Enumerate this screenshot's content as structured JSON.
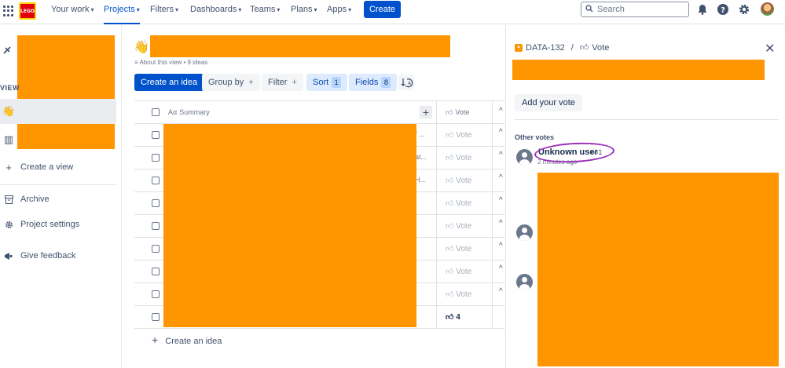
{
  "topnav": {
    "logo_text": "LEGO",
    "items": [
      {
        "label": "Your work",
        "active": false
      },
      {
        "label": "Projects",
        "active": true
      },
      {
        "label": "Filters",
        "active": false
      },
      {
        "label": "Dashboards",
        "active": false
      },
      {
        "label": "Teams",
        "active": false
      },
      {
        "label": "Plans",
        "active": false
      },
      {
        "label": "Apps",
        "active": false
      }
    ],
    "create_label": "Create",
    "search_placeholder": "Search",
    "icons": [
      "notifications-icon",
      "help-icon",
      "settings-icon"
    ]
  },
  "sidebar": {
    "views_label": "VIEW",
    "items": [
      {
        "label": "Create a view",
        "icon": "plus-icon"
      },
      {
        "label": "Archive",
        "icon": "archive-icon"
      },
      {
        "label": "Project settings",
        "icon": "gear-icon"
      },
      {
        "label": "Give feedback",
        "icon": "megaphone-icon"
      }
    ]
  },
  "main": {
    "about": "About this view • 9 ideas",
    "toolbar": {
      "create_idea": "Create an idea",
      "group_by": "Group by",
      "filter": "Filter",
      "sort": "Sort",
      "sort_count": "1",
      "fields": "Fields",
      "fields_count": "8"
    },
    "table": {
      "summary_header": "Summary",
      "summary_prefix": "Aα",
      "vote_header": "Vote",
      "rows": [
        {
          "trail": "f ...",
          "vote": "Vote",
          "caret": "^"
        },
        {
          "trail": "at...",
          "vote": "Vote",
          "caret": "^"
        },
        {
          "trail": "H...",
          "vote": "Vote",
          "caret": "^"
        },
        {
          "trail": "",
          "vote": "Vote",
          "caret": "^"
        },
        {
          "trail": "",
          "vote": "Vote",
          "caret": "^"
        },
        {
          "trail": "",
          "vote": "Vote",
          "caret": "^"
        },
        {
          "trail": "",
          "vote": "Vote",
          "caret": "^"
        },
        {
          "trail": "",
          "vote": "Vote",
          "caret": "^"
        },
        {
          "trail": "",
          "vote": "4",
          "caret": ""
        }
      ],
      "create_idea": "Create an idea"
    }
  },
  "panel": {
    "issue_key": "DATA-132",
    "separator": "/",
    "vote_label": "Vote",
    "add_vote": "Add your vote",
    "other_votes": "Other votes",
    "voter": {
      "name": "Unknown user",
      "count": "1",
      "time": "2 minutes ago"
    },
    "redaction_color": "#ff9500",
    "annotation_color": "#9b2fb8"
  }
}
